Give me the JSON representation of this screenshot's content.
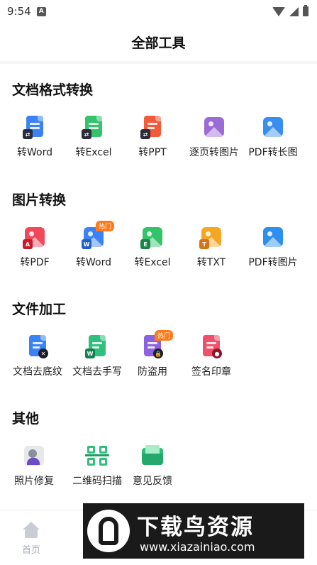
{
  "status_bar": {
    "time": "9:54",
    "app_icon": "A"
  },
  "header": {
    "title": "全部工具"
  },
  "sections": [
    {
      "title": "文档格式转换",
      "tools": [
        {
          "label": "转Word",
          "icon": "word-doc-icon",
          "color": "#3b82f6"
        },
        {
          "label": "转Excel",
          "icon": "excel-doc-icon",
          "color": "#34c36b"
        },
        {
          "label": "转PPT",
          "icon": "ppt-doc-icon",
          "color": "#f25a3c"
        },
        {
          "label": "逐页转图片",
          "icon": "image-pages-icon",
          "color": "#9b6bd8"
        },
        {
          "label": "PDF转长图",
          "icon": "long-image-icon",
          "color": "#3a8ef0"
        }
      ]
    },
    {
      "title": "图片转换",
      "tools": [
        {
          "label": "转PDF",
          "icon": "pdf-image-icon",
          "color": "#f04a5a"
        },
        {
          "label": "转Word",
          "icon": "word-image-icon",
          "color": "#3b82f6",
          "badge": "热门"
        },
        {
          "label": "转Excel",
          "icon": "excel-image-icon",
          "color": "#34c36b"
        },
        {
          "label": "转TXT",
          "icon": "txt-image-icon",
          "color": "#f5a623"
        },
        {
          "label": "PDF转图片",
          "icon": "pdf-to-image-icon",
          "color": "#2f8ff0"
        }
      ]
    },
    {
      "title": "文件加工",
      "tools": [
        {
          "label": "文档去底纹",
          "icon": "remove-shading-icon",
          "color": "#3b82f6"
        },
        {
          "label": "文档去手写",
          "icon": "remove-handwriting-icon",
          "color": "#2fc07e"
        },
        {
          "label": "防盗用",
          "icon": "anti-theft-lock-icon",
          "color": "#8b63e0",
          "badge": "热门"
        },
        {
          "label": "签名印章",
          "icon": "signature-stamp-icon",
          "color": "#f0506a"
        }
      ]
    },
    {
      "title": "其他",
      "tools": [
        {
          "label": "照片修复",
          "icon": "photo-repair-icon",
          "color": "#8c8f99"
        },
        {
          "label": "二维码扫描",
          "icon": "qr-scan-icon",
          "color": "#2fc07e"
        },
        {
          "label": "意见反馈",
          "icon": "feedback-icon",
          "color": "#2fc07e"
        }
      ]
    }
  ],
  "tabbar": {
    "home_label": "首页"
  },
  "watermark": {
    "title": "下载鸟资源",
    "url": "www.xiazainiao.com"
  }
}
